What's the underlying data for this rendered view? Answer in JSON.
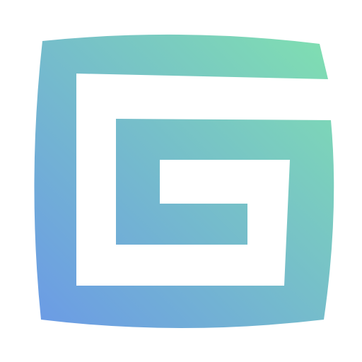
{
  "logo": {
    "icon": "spiral-g-icon",
    "gradient_start": "#6B9AE6",
    "gradient_end": "#80E0B0",
    "background": "#FFFFFF"
  }
}
